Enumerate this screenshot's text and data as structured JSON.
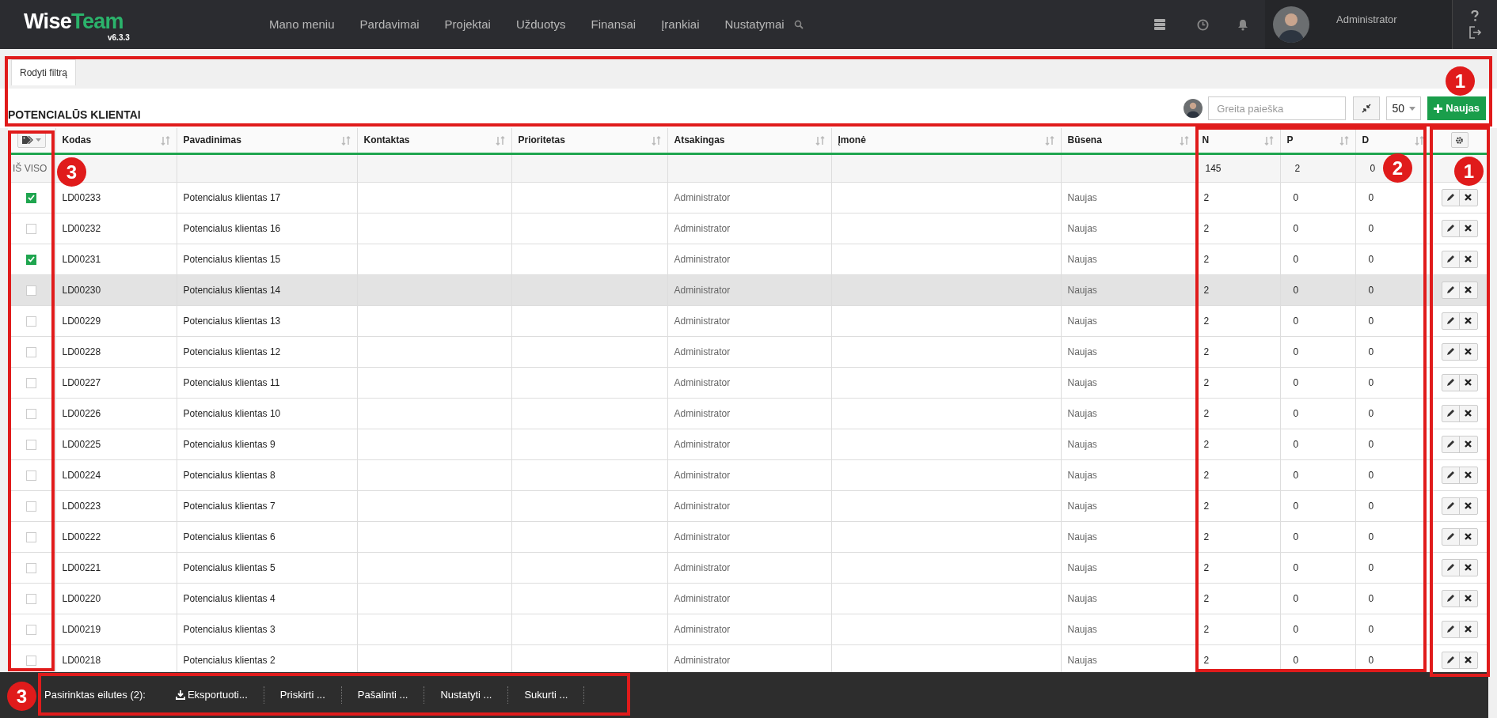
{
  "app": {
    "logo_primary": "Wise",
    "logo_accent": "Team",
    "version": "v6.3.3"
  },
  "nav": [
    "Mano meniu",
    "Pardavimai",
    "Projektai",
    "Užduotys",
    "Finansai",
    "Įrankiai",
    "Nustatymai"
  ],
  "user": {
    "name": "Administrator"
  },
  "filter_tab": "Rodyti filtrą",
  "title": "POTENCIALŪS KLIENTAI",
  "search": {
    "placeholder": "Greita paieška"
  },
  "page_size": "50",
  "new_button": "Naujas",
  "table": {
    "columns": [
      "Kodas",
      "Pavadinimas",
      "Kontaktas",
      "Prioritetas",
      "Atsakingas",
      "Įmonė",
      "Būsena",
      "N",
      "P",
      "D"
    ],
    "totals": {
      "label": "IŠ VISO",
      "n": "145",
      "p": "2",
      "d": "0"
    },
    "rows": [
      {
        "checked": true,
        "hovered": false,
        "code": "LD00233",
        "name": "Potencialus klientas 17",
        "owner": "Administrator",
        "status": "Naujas",
        "n": "2",
        "p": "0",
        "d": "0"
      },
      {
        "checked": false,
        "hovered": false,
        "code": "LD00232",
        "name": "Potencialus klientas 16",
        "owner": "Administrator",
        "status": "Naujas",
        "n": "2",
        "p": "0",
        "d": "0"
      },
      {
        "checked": true,
        "hovered": false,
        "code": "LD00231",
        "name": "Potencialus klientas 15",
        "owner": "Administrator",
        "status": "Naujas",
        "n": "2",
        "p": "0",
        "d": "0"
      },
      {
        "checked": false,
        "hovered": true,
        "code": "LD00230",
        "name": "Potencialus klientas 14",
        "owner": "Administrator",
        "status": "Naujas",
        "n": "2",
        "p": "0",
        "d": "0"
      },
      {
        "checked": false,
        "hovered": false,
        "code": "LD00229",
        "name": "Potencialus klientas 13",
        "owner": "Administrator",
        "status": "Naujas",
        "n": "2",
        "p": "0",
        "d": "0"
      },
      {
        "checked": false,
        "hovered": false,
        "code": "LD00228",
        "name": "Potencialus klientas 12",
        "owner": "Administrator",
        "status": "Naujas",
        "n": "2",
        "p": "0",
        "d": "0"
      },
      {
        "checked": false,
        "hovered": false,
        "code": "LD00227",
        "name": "Potencialus klientas 11",
        "owner": "Administrator",
        "status": "Naujas",
        "n": "2",
        "p": "0",
        "d": "0"
      },
      {
        "checked": false,
        "hovered": false,
        "code": "LD00226",
        "name": "Potencialus klientas 10",
        "owner": "Administrator",
        "status": "Naujas",
        "n": "2",
        "p": "0",
        "d": "0"
      },
      {
        "checked": false,
        "hovered": false,
        "code": "LD00225",
        "name": "Potencialus klientas 9",
        "owner": "Administrator",
        "status": "Naujas",
        "n": "2",
        "p": "0",
        "d": "0"
      },
      {
        "checked": false,
        "hovered": false,
        "code": "LD00224",
        "name": "Potencialus klientas 8",
        "owner": "Administrator",
        "status": "Naujas",
        "n": "2",
        "p": "0",
        "d": "0"
      },
      {
        "checked": false,
        "hovered": false,
        "code": "LD00223",
        "name": "Potencialus klientas 7",
        "owner": "Administrator",
        "status": "Naujas",
        "n": "2",
        "p": "0",
        "d": "0"
      },
      {
        "checked": false,
        "hovered": false,
        "code": "LD00222",
        "name": "Potencialus klientas 6",
        "owner": "Administrator",
        "status": "Naujas",
        "n": "2",
        "p": "0",
        "d": "0"
      },
      {
        "checked": false,
        "hovered": false,
        "code": "LD00221",
        "name": "Potencialus klientas 5",
        "owner": "Administrator",
        "status": "Naujas",
        "n": "2",
        "p": "0",
        "d": "0"
      },
      {
        "checked": false,
        "hovered": false,
        "code": "LD00220",
        "name": "Potencialus klientas 4",
        "owner": "Administrator",
        "status": "Naujas",
        "n": "2",
        "p": "0",
        "d": "0"
      },
      {
        "checked": false,
        "hovered": false,
        "code": "LD00219",
        "name": "Potencialus klientas 3",
        "owner": "Administrator",
        "status": "Naujas",
        "n": "2",
        "p": "0",
        "d": "0"
      },
      {
        "checked": false,
        "hovered": false,
        "code": "LD00218",
        "name": "Potencialus klientas 2",
        "owner": "Administrator",
        "status": "Naujas",
        "n": "2",
        "p": "0",
        "d": "0"
      }
    ]
  },
  "selection_bar": {
    "label": "Pasirinktas eilutes (2):",
    "actions": [
      {
        "label": "Eksportuoti...",
        "kind": "download"
      },
      {
        "label": "Priskirti ...",
        "kind": "plain"
      },
      {
        "label": "Pašalinti ...",
        "kind": "plain"
      },
      {
        "label": "Nustatyti ...",
        "kind": "plain"
      },
      {
        "label": "Sukurti ...",
        "kind": "plain"
      }
    ]
  },
  "callouts": [
    "1",
    "3",
    "2",
    "1",
    "3"
  ]
}
